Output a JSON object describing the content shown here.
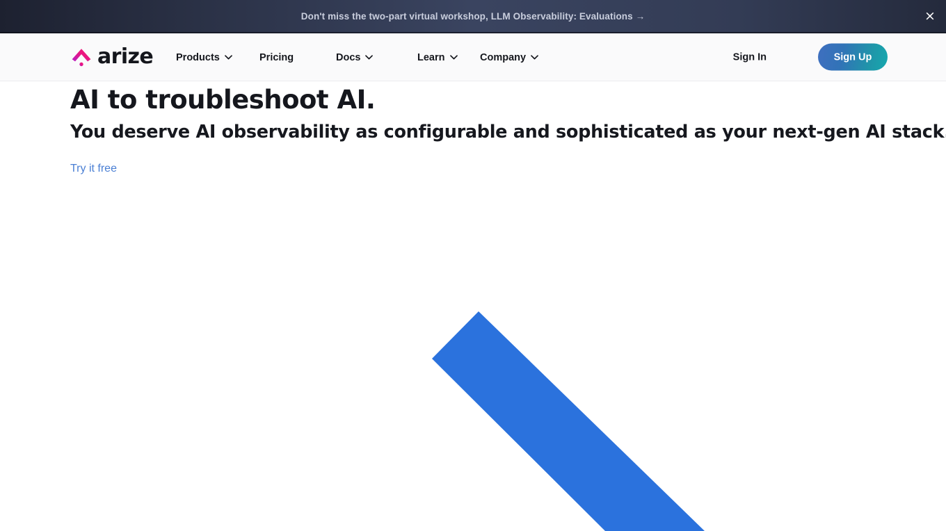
{
  "banner": {
    "text": "Don't miss the two-part virtual workshop, LLM Observability: Evaluations →",
    "close_icon": "close-icon",
    "close_glyph": "×",
    "background_from": "#1d2130",
    "background_to": "#3a4460",
    "text_color": "#c9cedd"
  },
  "header": {
    "logo": {
      "wordmark": "arize",
      "mark_icon": "arize-chevron-logo-icon",
      "mark_color": "#e8178a",
      "wordmark_color": "#14161c"
    },
    "nav_items": [
      {
        "label": "Products",
        "has_dropdown": true,
        "icon": "chevron-down-icon"
      },
      {
        "label": "Pricing",
        "has_dropdown": false,
        "icon": ""
      },
      {
        "label": "Docs",
        "has_dropdown": true,
        "icon": "chevron-down-icon"
      },
      {
        "label": "Learn",
        "has_dropdown": true,
        "icon": "chevron-down-icon"
      },
      {
        "label": "Company",
        "has_dropdown": true,
        "icon": "chevron-down-icon"
      }
    ],
    "sign_in_label": "Sign In",
    "sign_up_label": "Sign Up",
    "sign_up_gradient_from": "#3f6fc0",
    "sign_up_gradient_to": "#16a8ae",
    "background": "#fafafb"
  },
  "hero": {
    "heading": "AI to troubleshoot AI.",
    "subheading": "You deserve AI observability as configurable and sophisticated as your next-gen AI stack.",
    "cta_label": "Try it free",
    "cta_color": "#4a7fd4",
    "heading_color": "#15171d"
  },
  "decoration": {
    "shape": "diagonal-bar",
    "color": "#2b72dd"
  }
}
